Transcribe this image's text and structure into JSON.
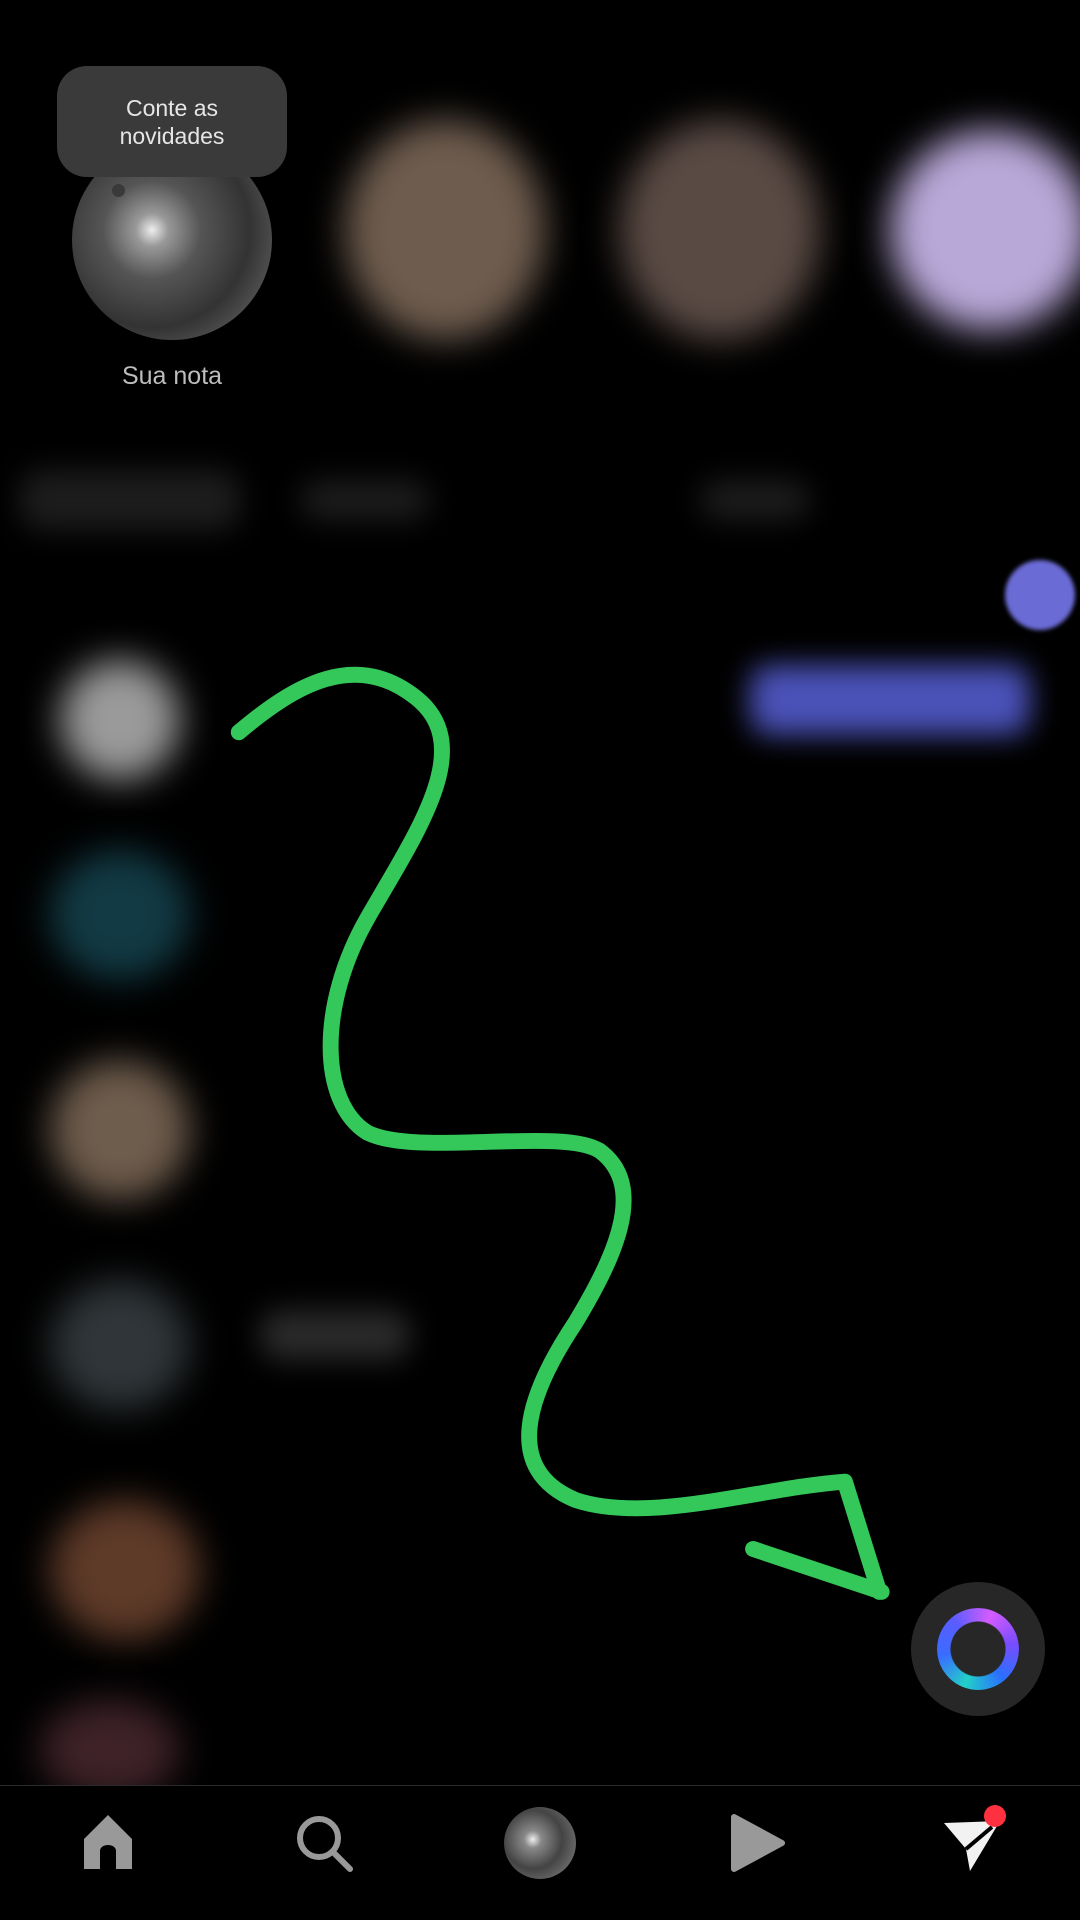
{
  "notes": {
    "my_note_prompt": "Conte as novidades",
    "my_note_label": "Sua nota"
  },
  "colors": {
    "annotation_arrow": "#34c759",
    "badge": "#ff3040",
    "ai_button_bg": "#272727"
  },
  "nav": {
    "items": [
      "home",
      "search",
      "profile",
      "reels",
      "direct"
    ]
  }
}
